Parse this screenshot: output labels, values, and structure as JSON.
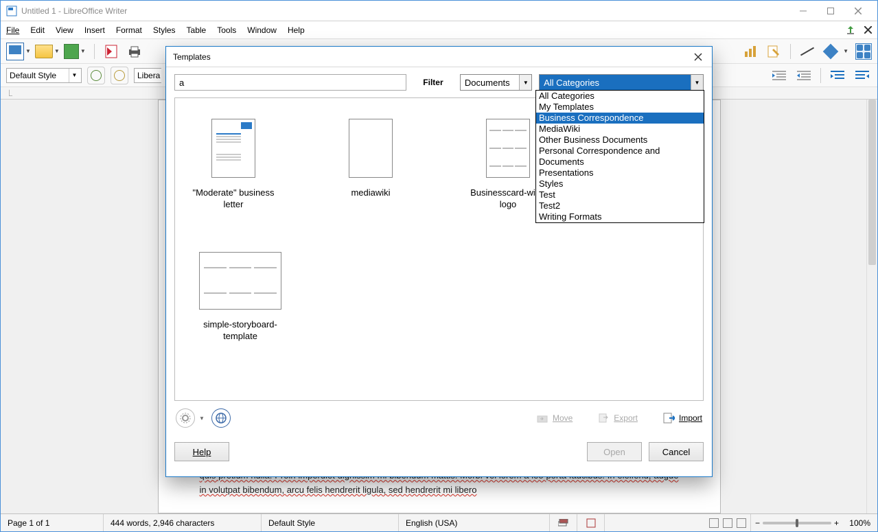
{
  "window": {
    "title": "Untitled 1 - LibreOffice Writer"
  },
  "menubar": {
    "file": "File",
    "edit": "Edit",
    "view": "View",
    "insert": "Insert",
    "format": "Format",
    "styles": "Styles",
    "table": "Table",
    "tools": "Tools",
    "window": "Window",
    "help": "Help"
  },
  "toolbar2": {
    "paragraph_style": "Default Style",
    "font_name_partial": "Libera"
  },
  "document": {
    "paragraph": "quis pretium nulla. Proin imperdiet dignissim mi bibendum mattis. Morbi vel lorem a leo porta faucibus. In eleifend, augue in volutpat bibendum, arcu felis hendrerit ligula, sed hendrerit mi libero"
  },
  "statusbar": {
    "page": "Page 1 of 1",
    "words": "444 words, 2,946 characters",
    "style": "Default Style",
    "language": "English (USA)",
    "zoom": "100%"
  },
  "dialog": {
    "title": "Templates",
    "search_value": "a",
    "filter_label": "Filter",
    "filter_type": "Documents",
    "filter_category": "All Categories",
    "category_options": [
      "All Categories",
      "My Templates",
      "Business Correspondence",
      "MediaWiki",
      "Other Business Documents",
      "Personal Correspondence and Documents",
      "Presentations",
      "Styles",
      "Test",
      "Test2",
      "Writing Formats"
    ],
    "category_highlight_index": 2,
    "templates": [
      {
        "label": "\"Moderate\" business letter"
      },
      {
        "label": "mediawiki"
      },
      {
        "label": "Businesscard-with-logo"
      },
      {
        "label": "simple-storyboard-template"
      }
    ],
    "actions": {
      "move": "Move",
      "export": "Export",
      "import": "Import"
    },
    "buttons": {
      "help": "Help",
      "open": "Open",
      "cancel": "Cancel"
    }
  }
}
